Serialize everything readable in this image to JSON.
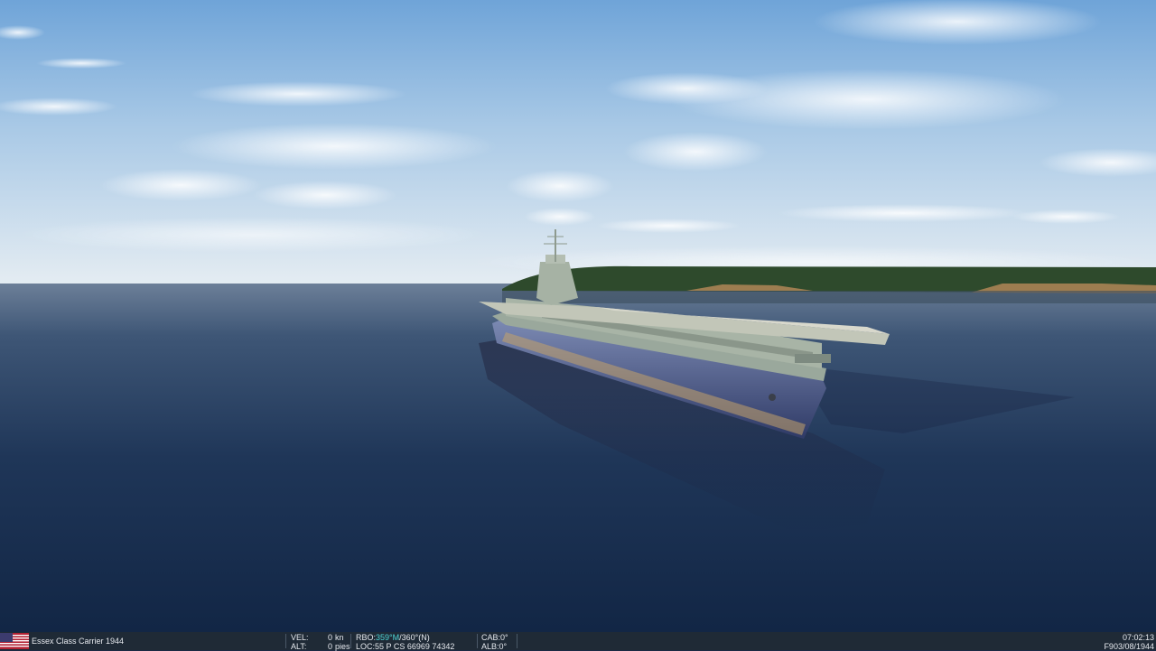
{
  "status_bar": {
    "unit_name": "Essex Class Carrier 1944",
    "flag_icon": "usa-flag-icon",
    "vel_label": "VEL:",
    "vel_value": "0",
    "vel_unit": "kn",
    "alt_label": "ALT:",
    "alt_value": "0",
    "alt_unit": "pies",
    "rbo_label": "RBO:",
    "rbo_magnetic": "359°M",
    "rbo_true": "/360°(N)",
    "loc_label": "LOC:",
    "loc_value": "55 P CS 66969 74342",
    "cab_label": "CAB:",
    "cab_value": "0°",
    "alb_label": "ALB:",
    "alb_value": "0°",
    "time": "07:02:13",
    "frame_label": "F9",
    "date": "03/08/1944"
  },
  "colors": {
    "bar_bg": "#1f2a36",
    "text": "#e6e9ee",
    "highlight": "#4fd6d6"
  }
}
